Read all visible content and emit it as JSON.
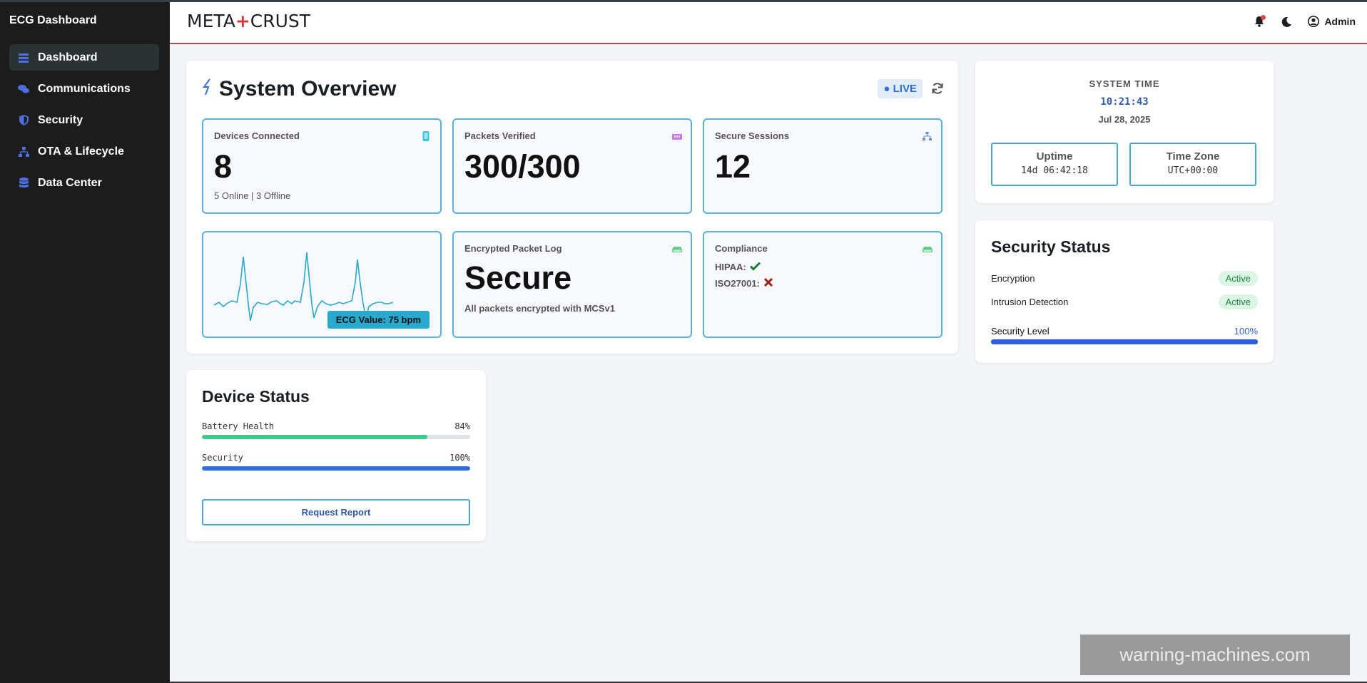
{
  "sidebar": {
    "title": "ECG Dashboard",
    "items": [
      {
        "label": "Dashboard",
        "icon": "dashboard-icon",
        "active": true
      },
      {
        "label": "Communications",
        "icon": "comments-icon",
        "active": false
      },
      {
        "label": "Security",
        "icon": "shield-icon",
        "active": false
      },
      {
        "label": "OTA & Lifecycle",
        "icon": "network-icon",
        "active": false
      },
      {
        "label": "Data Center",
        "icon": "database-icon",
        "active": false
      }
    ]
  },
  "header": {
    "logo_left": "META",
    "logo_plus": "+",
    "logo_right": "CRUST",
    "user": "Admin"
  },
  "overview": {
    "title": "System Overview",
    "live": "● LIVE",
    "tiles": {
      "devices": {
        "label": "Devices Connected",
        "value": "8",
        "sub": "5 Online | 3 Offline"
      },
      "packets": {
        "label": "Packets Verified",
        "value": "300/300"
      },
      "sessions": {
        "label": "Secure Sessions",
        "value": "12"
      },
      "ecg": {
        "badge": "ECG Value: 75 bpm"
      },
      "log": {
        "label": "Encrypted Packet Log",
        "value": "Secure",
        "sub": "All packets encrypted with MCSv1"
      },
      "compliance": {
        "label": "Compliance",
        "hipaa": "HIPAA:",
        "iso": "ISO27001:",
        "hipaa_ok": true,
        "iso_ok": false
      }
    }
  },
  "device_status": {
    "title": "Device Status",
    "battery": {
      "label": "Battery Health",
      "pct": "84%",
      "fraction": 0.84
    },
    "security": {
      "label": "Security",
      "pct": "100%",
      "fraction": 1.0
    },
    "button": "Request Report"
  },
  "system_time": {
    "label": "SYSTEM TIME",
    "time": "10:21:43",
    "date": "Jul 28, 2025",
    "uptime_label": "Uptime",
    "uptime_value": "14d 06:42:18",
    "tz_label": "Time Zone",
    "tz_value": "UTC+00:00"
  },
  "security_status": {
    "title": "Security Status",
    "encryption_label": "Encryption",
    "encryption_value": "Active",
    "intrusion_label": "Intrusion Detection",
    "intrusion_value": "Active",
    "level_label": "Security Level",
    "level_pct": "100%",
    "level_fraction": 1.0
  },
  "watermark": "warning-machines.com",
  "colors": {
    "accent": "#2d6fd1",
    "tile_border": "#57b3da",
    "battery_bar": "#41c98a",
    "security_bar": "#2d6fe0",
    "header_rule": "#b8454f",
    "ecg_line": "#2aa9ce"
  }
}
